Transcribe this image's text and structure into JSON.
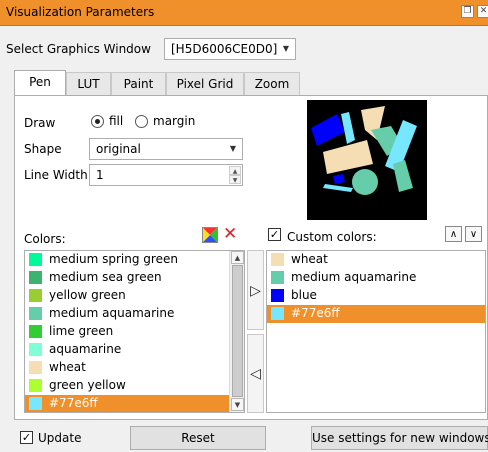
{
  "window": {
    "title": "Visualization Parameters"
  },
  "graphics_window": {
    "label": "Select Graphics Window",
    "value": "[H5D6006CE0D0]"
  },
  "tabs": [
    {
      "label": "Pen"
    },
    {
      "label": "LUT"
    },
    {
      "label": "Paint"
    },
    {
      "label": "Pixel Grid"
    },
    {
      "label": "Zoom"
    }
  ],
  "pen": {
    "draw_label": "Draw",
    "draw_options": [
      {
        "label": "fill",
        "selected": true
      },
      {
        "label": "margin",
        "selected": false
      }
    ],
    "shape_label": "Shape",
    "shape_value": "original",
    "line_width_label": "Line Width",
    "line_width_value": "1"
  },
  "colors": {
    "label": "Colors:",
    "items": [
      {
        "label": "medium spring green",
        "color": "#00fa9a"
      },
      {
        "label": "medium sea green",
        "color": "#3cb371"
      },
      {
        "label": "yellow green",
        "color": "#9acd32"
      },
      {
        "label": "medium aquamarine",
        "color": "#66cdaa"
      },
      {
        "label": "lime green",
        "color": "#32cd32"
      },
      {
        "label": "aquamarine",
        "color": "#7fffd4"
      },
      {
        "label": "wheat",
        "color": "#f5deb3"
      },
      {
        "label": "green yellow",
        "color": "#adff2f"
      },
      {
        "label": "#77e6ff",
        "color": "#77e6ff",
        "selected": true
      }
    ]
  },
  "custom_colors": {
    "label": "Custom colors:",
    "checked": true,
    "items": [
      {
        "label": "wheat",
        "color": "#f5deb3"
      },
      {
        "label": "medium aquamarine",
        "color": "#66cdaa"
      },
      {
        "label": "blue",
        "color": "#0000ff"
      },
      {
        "label": "#77e6ff",
        "color": "#77e6ff",
        "selected": true
      }
    ]
  },
  "footer": {
    "update_label": "Update",
    "update_checked": true,
    "reset_label": "Reset",
    "new_windows_label": "Use settings for new windows"
  },
  "theme": {
    "accent": "#f0902a"
  }
}
